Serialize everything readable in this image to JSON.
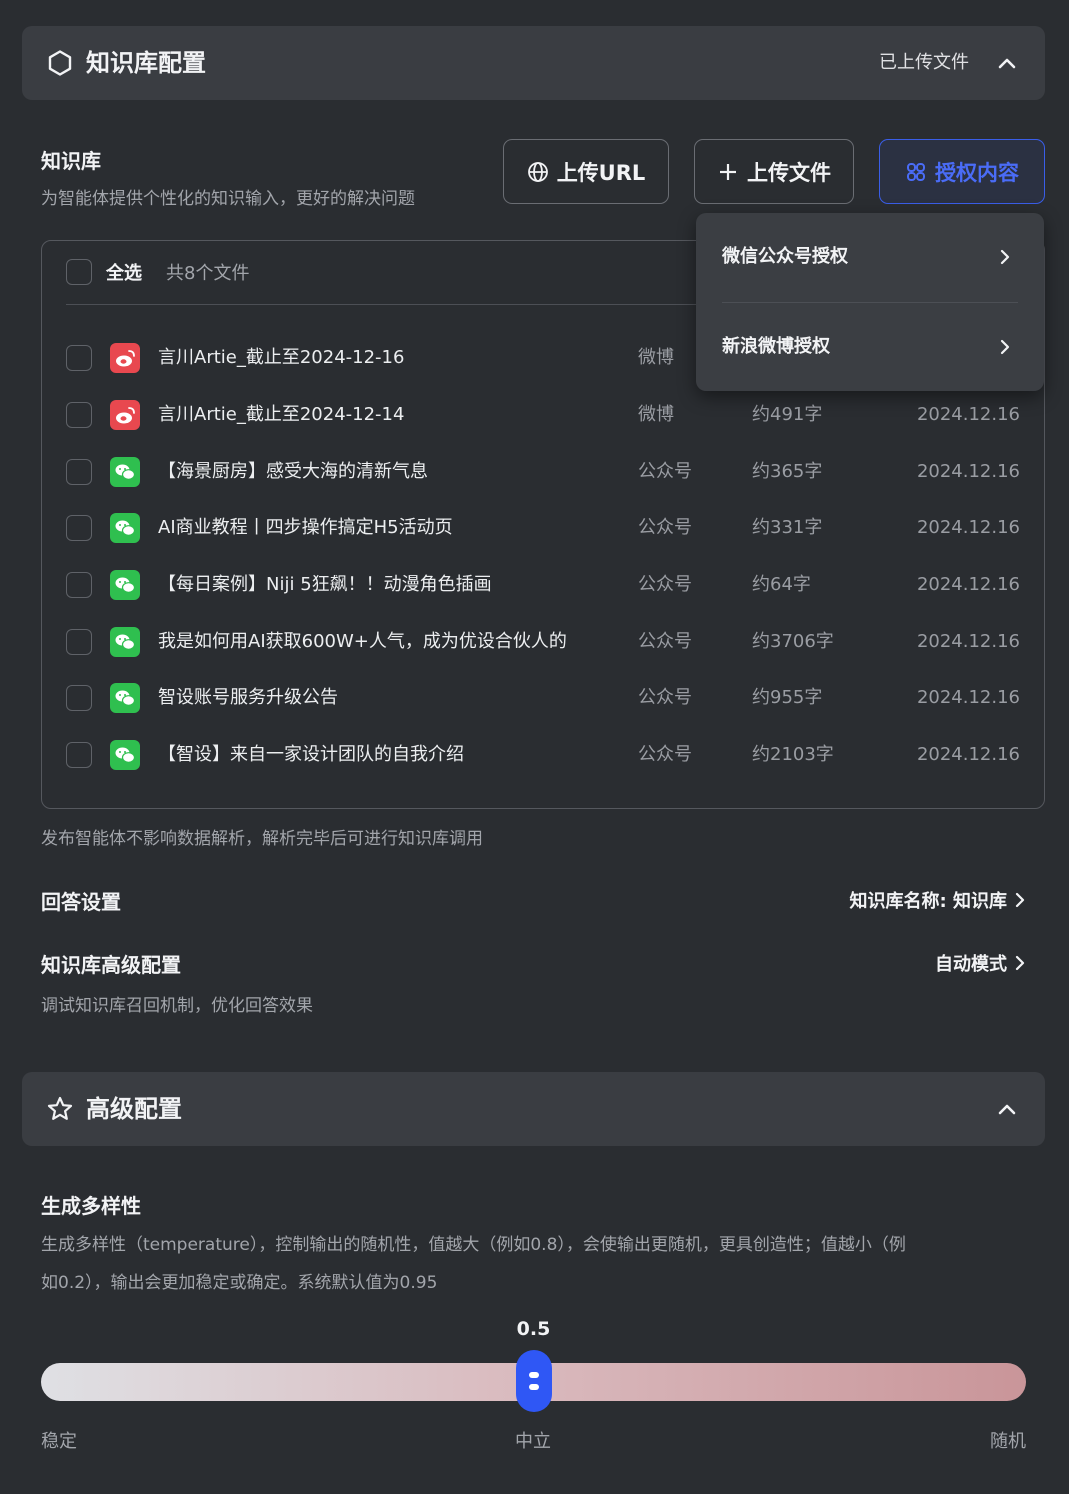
{
  "kb_panel": {
    "title": "知识库配置",
    "uploaded_label": "已上传文件"
  },
  "kb_section": {
    "title": "知识库",
    "desc": "为智能体提供个性化的知识输入，更好的解决问题",
    "btn_upload_url": "上传URL",
    "btn_upload_file": "上传文件",
    "btn_authorize": "授权内容"
  },
  "dropdown": {
    "items": [
      {
        "label": "微信公众号授权"
      },
      {
        "label": "新浪微博授权"
      }
    ]
  },
  "file_list": {
    "select_all": "全选",
    "count": "共8个文件",
    "files": [
      {
        "name": "言川Artie_截止至2024-12-16",
        "source": "微博",
        "size": "",
        "date": "",
        "type": "weibo"
      },
      {
        "name": "言川Artie_截止至2024-12-14",
        "source": "微博",
        "size": "约491字",
        "date": "2024.12.16",
        "type": "weibo"
      },
      {
        "name": "【海景厨房】感受大海的清新气息",
        "source": "公众号",
        "size": "约365字",
        "date": "2024.12.16",
        "type": "wechat"
      },
      {
        "name": "AI商业教程丨四步操作搞定H5活动页",
        "source": "公众号",
        "size": "约331字",
        "date": "2024.12.16",
        "type": "wechat"
      },
      {
        "name": "【每日案例】Niji 5狂飙！！动漫角色插画",
        "source": "公众号",
        "size": "约64字",
        "date": "2024.12.16",
        "type": "wechat"
      },
      {
        "name": "我是如何用AI获取600W+人气，成为优设合伙人的",
        "source": "公众号",
        "size": "约3706字",
        "date": "2024.12.16",
        "type": "wechat"
      },
      {
        "name": "智设账号服务升级公告",
        "source": "公众号",
        "size": "约955字",
        "date": "2024.12.16",
        "type": "wechat"
      },
      {
        "name": "【智设】来自一家设计团队的自我介绍",
        "source": "公众号",
        "size": "约2103字",
        "date": "2024.12.16",
        "type": "wechat"
      }
    ],
    "footnote": "发布智能体不影响数据解析，解析完毕后可进行知识库调用"
  },
  "answer_settings": {
    "title": "回答设置",
    "link": "知识库名称: 知识库"
  },
  "kb_advanced": {
    "title": "知识库高级配置",
    "desc": "调试知识库召回机制，优化回答效果",
    "link": "自动模式"
  },
  "adv_panel": {
    "title": "高级配置"
  },
  "diversity": {
    "title": "生成多样性",
    "desc_line1": "生成多样性（temperature），控制输出的随机性，值越大（例如0.8），会使输出更随机，更具创造性；值越小（例",
    "desc_line2": "如0.2），输出会更加稳定或确定。系统默认值为0.95",
    "value": "0.5",
    "value_num": 0.5,
    "label_left": "稳定",
    "label_mid": "中立",
    "label_right": "随机"
  },
  "colors": {
    "accent": "#2f57f5",
    "weibo": "#e8484f",
    "wechat": "#2fbf4f"
  }
}
